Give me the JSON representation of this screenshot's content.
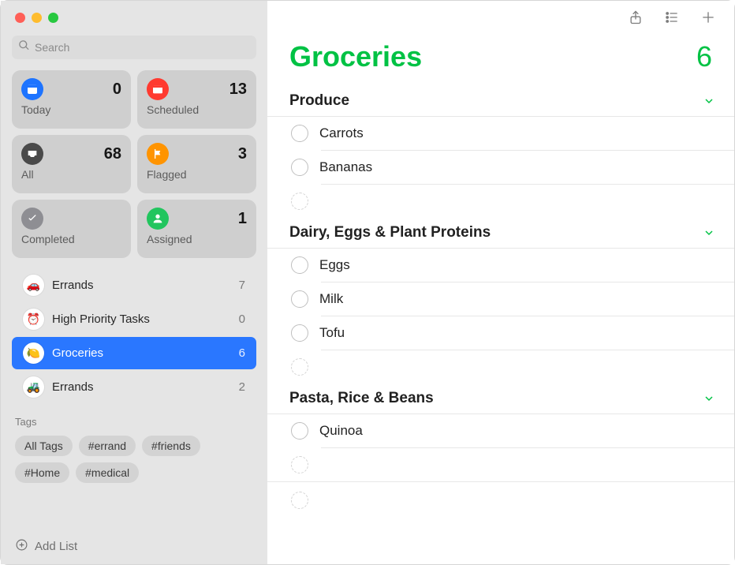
{
  "sidebar": {
    "search_placeholder": "Search",
    "smart": [
      {
        "key": "today",
        "label": "Today",
        "count": 0,
        "color": "bg-blue"
      },
      {
        "key": "scheduled",
        "label": "Scheduled",
        "count": 13,
        "color": "bg-red"
      },
      {
        "key": "all",
        "label": "All",
        "count": 68,
        "color": "bg-dark"
      },
      {
        "key": "flagged",
        "label": "Flagged",
        "count": 3,
        "color": "bg-orange"
      },
      {
        "key": "completed",
        "label": "Completed",
        "count": "",
        "color": "bg-gray"
      },
      {
        "key": "assigned",
        "label": "Assigned",
        "count": 1,
        "color": "bg-green"
      }
    ],
    "lists": [
      {
        "label": "Errands",
        "count": 7,
        "emoji": "🚗",
        "selected": false
      },
      {
        "label": "High Priority Tasks",
        "count": 0,
        "emoji": "⏰",
        "selected": false
      },
      {
        "label": "Groceries",
        "count": 6,
        "emoji": "🍋",
        "selected": true
      },
      {
        "label": "Errands",
        "count": 2,
        "emoji": "🚜",
        "selected": false
      }
    ],
    "tags_header": "Tags",
    "tags": [
      "All Tags",
      "#errand",
      "#friends",
      "#Home",
      "#medical"
    ],
    "add_list_label": "Add List"
  },
  "main": {
    "title": "Groceries",
    "count": 6,
    "accent": "#00c244",
    "sections": [
      {
        "name": "Produce",
        "items": [
          "Carrots",
          "Bananas"
        ]
      },
      {
        "name": "Dairy, Eggs & Plant Proteins",
        "items": [
          "Eggs",
          "Milk",
          "Tofu"
        ]
      },
      {
        "name": "Pasta, Rice & Beans",
        "items": [
          "Quinoa"
        ]
      }
    ]
  }
}
